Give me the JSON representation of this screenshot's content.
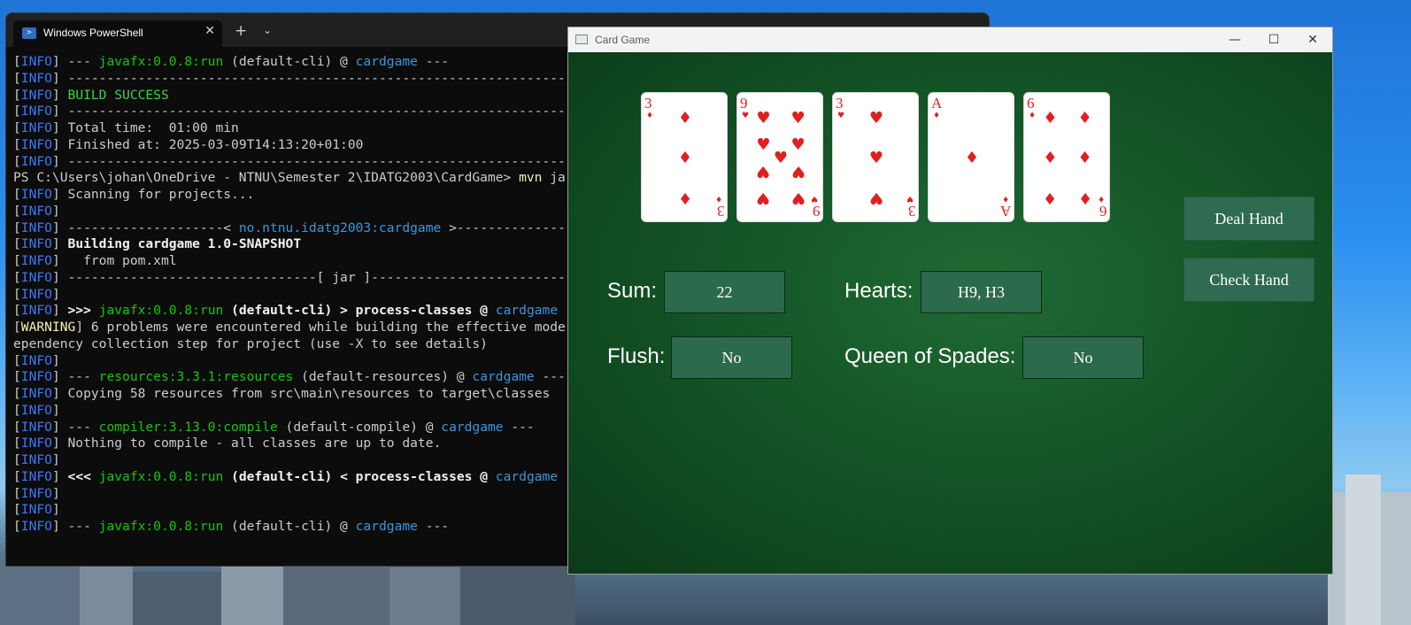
{
  "powershell": {
    "tab_title": "Windows PowerShell",
    "close_glyph": "✕",
    "new_tab_glyph": "+",
    "dropdown_glyph": "⌄",
    "lines": [
      [
        [
          "[",
          "w"
        ],
        [
          "INFO",
          "b"
        ],
        [
          "] --- ",
          "w"
        ],
        [
          "javafx:0.0.8:run",
          "g"
        ],
        [
          " (default-cli) @ ",
          "w"
        ],
        [
          "cardgame",
          "cyan"
        ],
        [
          " ---",
          "w"
        ]
      ],
      [
        [
          "[",
          "w"
        ],
        [
          "INFO",
          "b"
        ],
        [
          "] ------------------------------------------------------------------------",
          "w"
        ]
      ],
      [
        [
          "[",
          "w"
        ],
        [
          "INFO",
          "b"
        ],
        [
          "] ",
          "w"
        ],
        [
          "BUILD SUCCESS",
          "lg"
        ]
      ],
      [
        [
          "[",
          "w"
        ],
        [
          "INFO",
          "b"
        ],
        [
          "] ------------------------------------------------------------------------",
          "w"
        ]
      ],
      [
        [
          "[",
          "w"
        ],
        [
          "INFO",
          "b"
        ],
        [
          "] Total time:  01:00 min",
          "w"
        ]
      ],
      [
        [
          "[",
          "w"
        ],
        [
          "INFO",
          "b"
        ],
        [
          "] Finished at: 2025-03-09T14:13:20+01:00",
          "w"
        ]
      ],
      [
        [
          "[",
          "w"
        ],
        [
          "INFO",
          "b"
        ],
        [
          "] ------------------------------------------------------------------------",
          "w"
        ]
      ],
      [
        [
          "PS C:\\Users\\johan\\OneDrive - NTNU\\Semester 2\\IDATG2003\\CardGame> ",
          "w"
        ],
        [
          "mvn",
          "y"
        ],
        [
          " ja",
          "w"
        ]
      ],
      [
        [
          "[",
          "w"
        ],
        [
          "INFO",
          "b"
        ],
        [
          "] Scanning for projects...",
          "w"
        ]
      ],
      [
        [
          "[",
          "w"
        ],
        [
          "INFO",
          "b"
        ],
        [
          "]",
          "w"
        ]
      ],
      [
        [
          "[",
          "w"
        ],
        [
          "INFO",
          "b"
        ],
        [
          "] --------------------< ",
          "w"
        ],
        [
          "no.ntnu.idatg2003:cardgame",
          "cyan"
        ],
        [
          " >--------------------",
          "w"
        ]
      ],
      [
        [
          "[",
          "w"
        ],
        [
          "INFO",
          "b"
        ],
        [
          "] ",
          "w"
        ],
        [
          "Building cardgame 1.0-SNAPSHOT",
          "bold"
        ]
      ],
      [
        [
          "[",
          "w"
        ],
        [
          "INFO",
          "b"
        ],
        [
          "]   from pom.xml",
          "w"
        ]
      ],
      [
        [
          "[",
          "w"
        ],
        [
          "INFO",
          "b"
        ],
        [
          "] --------------------------------[ jar ]---------------------------------",
          "w"
        ]
      ],
      [
        [
          "[",
          "w"
        ],
        [
          "INFO",
          "b"
        ],
        [
          "]",
          "w"
        ]
      ],
      [
        [
          "[",
          "w"
        ],
        [
          "INFO",
          "b"
        ],
        [
          "] ",
          "w"
        ],
        [
          ">>> ",
          "bold"
        ],
        [
          "javafx:0.0.8:run",
          "g"
        ],
        [
          " (default-cli) > process-classes @ ",
          "bold"
        ],
        [
          "cardgame",
          "cyan"
        ]
      ],
      [
        [
          "[",
          "w"
        ],
        [
          "WARNING",
          "y"
        ],
        [
          "] 6 problems were encountered while building the effective mode",
          "w"
        ]
      ],
      [
        [
          "ependency collection step for project (use -X to see details)",
          "w"
        ]
      ],
      [
        [
          "[",
          "w"
        ],
        [
          "INFO",
          "b"
        ],
        [
          "]",
          "w"
        ]
      ],
      [
        [
          "[",
          "w"
        ],
        [
          "INFO",
          "b"
        ],
        [
          "] --- ",
          "w"
        ],
        [
          "resources:3.3.1:resources",
          "g"
        ],
        [
          " (default-resources) @ ",
          "w"
        ],
        [
          "cardgame",
          "cyan"
        ],
        [
          " ---",
          "w"
        ]
      ],
      [
        [
          "[",
          "w"
        ],
        [
          "INFO",
          "b"
        ],
        [
          "] Copying 58 resources from src\\main\\resources to target\\classes",
          "w"
        ]
      ],
      [
        [
          "[",
          "w"
        ],
        [
          "INFO",
          "b"
        ],
        [
          "]",
          "w"
        ]
      ],
      [
        [
          "[",
          "w"
        ],
        [
          "INFO",
          "b"
        ],
        [
          "] --- ",
          "w"
        ],
        [
          "compiler:3.13.0:compile",
          "g"
        ],
        [
          " (default-compile) @ ",
          "w"
        ],
        [
          "cardgame",
          "cyan"
        ],
        [
          " ---",
          "w"
        ]
      ],
      [
        [
          "[",
          "w"
        ],
        [
          "INFO",
          "b"
        ],
        [
          "] Nothing to compile - all classes are up to date.",
          "w"
        ]
      ],
      [
        [
          "[",
          "w"
        ],
        [
          "INFO",
          "b"
        ],
        [
          "]",
          "w"
        ]
      ],
      [
        [
          "[",
          "w"
        ],
        [
          "INFO",
          "b"
        ],
        [
          "] ",
          "w"
        ],
        [
          "<<< ",
          "bold"
        ],
        [
          "javafx:0.0.8:run",
          "g"
        ],
        [
          " (default-cli) < process-classes @ ",
          "bold"
        ],
        [
          "cardgame",
          "cyan"
        ]
      ],
      [
        [
          "[",
          "w"
        ],
        [
          "INFO",
          "b"
        ],
        [
          "]",
          "w"
        ]
      ],
      [
        [
          "[",
          "w"
        ],
        [
          "INFO",
          "b"
        ],
        [
          "]",
          "w"
        ]
      ],
      [
        [
          "[",
          "w"
        ],
        [
          "INFO",
          "b"
        ],
        [
          "] --- ",
          "w"
        ],
        [
          "javafx:0.0.8:run",
          "g"
        ],
        [
          " (default-cli) @ ",
          "w"
        ],
        [
          "cardgame",
          "cyan"
        ],
        [
          " ---",
          "w"
        ]
      ]
    ]
  },
  "cardgame": {
    "window_title": "Card Game",
    "minimize_glyph": "—",
    "maximize_glyph": "☐",
    "close_glyph": "✕",
    "cards": [
      {
        "rank": "3",
        "suit": "♦",
        "suit_name": "diamonds"
      },
      {
        "rank": "9",
        "suit": "♥",
        "suit_name": "hearts"
      },
      {
        "rank": "3",
        "suit": "♥",
        "suit_name": "hearts"
      },
      {
        "rank": "A",
        "suit": "♦",
        "suit_name": "diamonds"
      },
      {
        "rank": "6",
        "suit": "♦",
        "suit_name": "diamonds"
      }
    ],
    "labels": {
      "sum": "Sum:",
      "hearts": "Hearts:",
      "flush": "Flush:",
      "queen": "Queen of Spades:"
    },
    "values": {
      "sum": "22",
      "hearts": "H9, H3",
      "flush": "No",
      "queen": "No"
    },
    "buttons": {
      "deal": "Deal Hand",
      "check": "Check Hand"
    },
    "colors": {
      "felt": "#145526",
      "box": "#2b6a4a",
      "card_red": "#e02020"
    }
  }
}
